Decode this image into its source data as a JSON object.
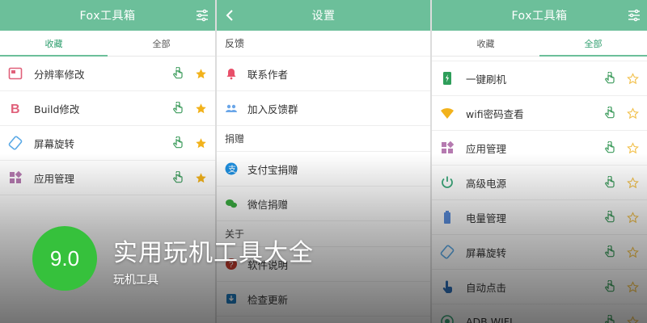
{
  "panel_left": {
    "header_title": "Fox工具箱",
    "tabs": [
      {
        "label": "收藏",
        "active": true
      },
      {
        "label": "全部",
        "active": false
      }
    ],
    "items": [
      {
        "label": "分辨率修改",
        "icon": "resolution-icon"
      },
      {
        "label": "Build修改",
        "icon": "build-b-icon"
      },
      {
        "label": "屏幕旋转",
        "icon": "rotate-icon"
      },
      {
        "label": "应用管理",
        "icon": "apps-icon"
      }
    ]
  },
  "panel_middle": {
    "header_title": "设置",
    "sections": [
      {
        "title": "反馈",
        "items": [
          {
            "label": "联系作者",
            "icon": "bell-icon"
          },
          {
            "label": "加入反馈群",
            "icon": "group-icon"
          }
        ]
      },
      {
        "title": "捐赠",
        "items": [
          {
            "label": "支付宝捐赠",
            "icon": "alipay-icon"
          },
          {
            "label": "微信捐赠",
            "icon": "wechat-icon"
          }
        ]
      },
      {
        "title": "关于",
        "items": [
          {
            "label": "软件说明",
            "icon": "help-icon"
          },
          {
            "label": "检查更新",
            "icon": "update-icon"
          }
        ]
      }
    ]
  },
  "panel_right": {
    "header_title": "Fox工具箱",
    "tabs": [
      {
        "label": "收藏",
        "active": false
      },
      {
        "label": "全部",
        "active": true
      }
    ],
    "items": [
      {
        "label": "一键刷机",
        "icon": "flash-phone-icon"
      },
      {
        "label": "wifi密码查看",
        "icon": "wifi-icon"
      },
      {
        "label": "应用管理",
        "icon": "apps-icon"
      },
      {
        "label": "高级电源",
        "icon": "power-icon"
      },
      {
        "label": "电量管理",
        "icon": "battery-icon"
      },
      {
        "label": "屏幕旋转",
        "icon": "rotate-icon"
      },
      {
        "label": "自动点击",
        "icon": "tap-icon"
      },
      {
        "label": "ADB WIFI",
        "icon": "adb-wifi-icon"
      }
    ]
  },
  "overlay": {
    "score": "9.0",
    "title": "实用玩机工具大全",
    "subtitle": "玩机工具"
  },
  "colors": {
    "accent": "#6cbf9a",
    "star_filled": "#f2b21b",
    "star_outline": "#f2c04a",
    "touch_icon": "#3a9a5a",
    "score_badge": "#36c13c"
  }
}
